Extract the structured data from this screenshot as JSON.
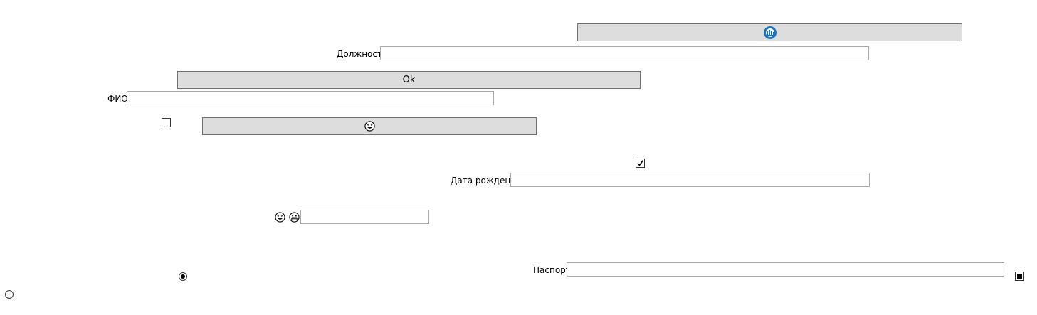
{
  "buttons": {
    "top_icon_button": {
      "icon": "cloud-upload-icon",
      "accent": "#1e73be"
    },
    "ok_button": {
      "label": "Ok"
    },
    "emoji_button": {
      "icon": "laughing-face-icon"
    }
  },
  "fields": {
    "position": {
      "label": "Должность",
      "value": ""
    },
    "full_name": {
      "label": "ФИО",
      "value": ""
    },
    "birth_date": {
      "label": "Дата рождения",
      "value": ""
    },
    "emoji_field": {
      "value": "",
      "icons": [
        "laughing-face-icon",
        "grinning-face-icon"
      ]
    },
    "passport": {
      "label": "Паспорт",
      "value": ""
    }
  },
  "checkboxes": {
    "unchecked_checkbox": {
      "checked": false
    },
    "checked_checkbox": {
      "checked": true
    },
    "square_checkbox": {
      "state": "indeterminate"
    }
  },
  "radios": {
    "selected_radio": {
      "selected": true
    },
    "unselected_radio": {
      "selected": false
    }
  }
}
